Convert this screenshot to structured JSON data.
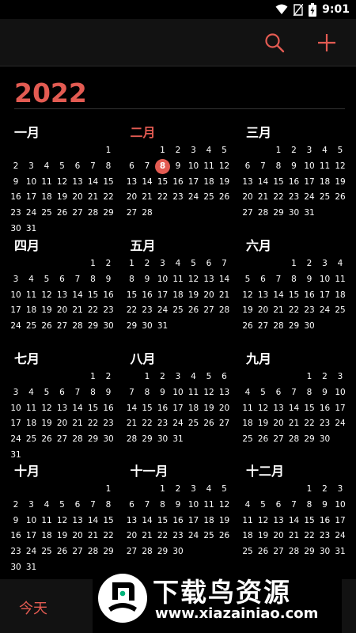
{
  "status_bar": {
    "time": "9:01",
    "icons": [
      "wifi-icon",
      "no-sim-icon",
      "battery-charging-icon"
    ]
  },
  "app_bar": {
    "icons": [
      "search-icon",
      "plus-icon"
    ]
  },
  "year": "2022",
  "months": [
    {
      "name": "一月",
      "weeks": [
        [
          "",
          "",
          "",
          "",
          "",
          "",
          "1"
        ],
        [
          "2",
          "3",
          "4",
          "5",
          "6",
          "7",
          "8"
        ],
        [
          "9",
          "10",
          "11",
          "12",
          "13",
          "14",
          "15"
        ],
        [
          "16",
          "17",
          "18",
          "19",
          "20",
          "21",
          "22"
        ],
        [
          "23",
          "24",
          "25",
          "26",
          "27",
          "28",
          "29"
        ],
        [
          "30",
          "31",
          "",
          "",
          "",
          "",
          ""
        ]
      ]
    },
    {
      "name": "二月",
      "current": true,
      "weeks": [
        [
          "",
          "",
          "1",
          "2",
          "3",
          "4",
          "5"
        ],
        [
          "6",
          "7",
          "8",
          "9",
          "10",
          "11",
          "12"
        ],
        [
          "13",
          "14",
          "15",
          "16",
          "17",
          "18",
          "19"
        ],
        [
          "20",
          "21",
          "22",
          "23",
          "24",
          "25",
          "26"
        ],
        [
          "27",
          "28",
          "",
          "",
          "",
          "",
          ""
        ]
      ]
    },
    {
      "name": "三月",
      "weeks": [
        [
          "",
          "",
          "1",
          "2",
          "3",
          "4",
          "5"
        ],
        [
          "6",
          "7",
          "8",
          "9",
          "10",
          "11",
          "12"
        ],
        [
          "13",
          "14",
          "15",
          "16",
          "17",
          "18",
          "19"
        ],
        [
          "20",
          "21",
          "22",
          "23",
          "24",
          "25",
          "26"
        ],
        [
          "27",
          "28",
          "29",
          "30",
          "31",
          "",
          ""
        ]
      ]
    },
    {
      "name": "四月",
      "weeks": [
        [
          "",
          "",
          "",
          "",
          "",
          "1",
          "2"
        ],
        [
          "3",
          "4",
          "5",
          "6",
          "7",
          "8",
          "9"
        ],
        [
          "10",
          "11",
          "12",
          "13",
          "14",
          "15",
          "16"
        ],
        [
          "17",
          "18",
          "19",
          "20",
          "21",
          "22",
          "23"
        ],
        [
          "24",
          "25",
          "26",
          "27",
          "28",
          "29",
          "30"
        ]
      ]
    },
    {
      "name": "五月",
      "weeks": [
        [
          "1",
          "2",
          "3",
          "4",
          "5",
          "6",
          "7"
        ],
        [
          "8",
          "9",
          "10",
          "11",
          "12",
          "13",
          "14"
        ],
        [
          "15",
          "16",
          "17",
          "18",
          "19",
          "20",
          "21"
        ],
        [
          "22",
          "23",
          "24",
          "25",
          "26",
          "27",
          "28"
        ],
        [
          "29",
          "30",
          "31",
          "",
          "",
          "",
          ""
        ]
      ]
    },
    {
      "name": "六月",
      "weeks": [
        [
          "",
          "",
          "",
          "1",
          "2",
          "3",
          "4"
        ],
        [
          "5",
          "6",
          "7",
          "8",
          "9",
          "10",
          "11"
        ],
        [
          "12",
          "13",
          "14",
          "15",
          "16",
          "17",
          "18"
        ],
        [
          "19",
          "20",
          "21",
          "22",
          "23",
          "24",
          "25"
        ],
        [
          "26",
          "27",
          "28",
          "29",
          "30",
          "",
          ""
        ]
      ]
    },
    {
      "name": "七月",
      "weeks": [
        [
          "",
          "",
          "",
          "",
          "",
          "1",
          "2"
        ],
        [
          "3",
          "4",
          "5",
          "6",
          "7",
          "8",
          "9"
        ],
        [
          "10",
          "11",
          "12",
          "13",
          "14",
          "15",
          "16"
        ],
        [
          "17",
          "18",
          "19",
          "20",
          "21",
          "22",
          "23"
        ],
        [
          "24",
          "25",
          "26",
          "27",
          "28",
          "29",
          "30"
        ],
        [
          "31",
          "",
          "",
          "",
          "",
          "",
          ""
        ]
      ]
    },
    {
      "name": "八月",
      "weeks": [
        [
          "",
          "1",
          "2",
          "3",
          "4",
          "5",
          "6"
        ],
        [
          "7",
          "8",
          "9",
          "10",
          "11",
          "12",
          "13"
        ],
        [
          "14",
          "15",
          "16",
          "17",
          "18",
          "19",
          "20"
        ],
        [
          "21",
          "22",
          "23",
          "24",
          "25",
          "26",
          "27"
        ],
        [
          "28",
          "29",
          "30",
          "31",
          "",
          "",
          ""
        ]
      ]
    },
    {
      "name": "九月",
      "weeks": [
        [
          "",
          "",
          "",
          "",
          "1",
          "2",
          "3"
        ],
        [
          "4",
          "5",
          "6",
          "7",
          "8",
          "9",
          "10"
        ],
        [
          "11",
          "12",
          "13",
          "14",
          "15",
          "16",
          "17"
        ],
        [
          "18",
          "19",
          "20",
          "21",
          "22",
          "23",
          "24"
        ],
        [
          "25",
          "26",
          "27",
          "28",
          "29",
          "30",
          ""
        ]
      ]
    },
    {
      "name": "十月",
      "weeks": [
        [
          "",
          "",
          "",
          "",
          "",
          "",
          "1"
        ],
        [
          "2",
          "3",
          "4",
          "5",
          "6",
          "7",
          "8"
        ],
        [
          "9",
          "10",
          "11",
          "12",
          "13",
          "14",
          "15"
        ],
        [
          "16",
          "17",
          "18",
          "19",
          "20",
          "21",
          "22"
        ],
        [
          "23",
          "24",
          "25",
          "26",
          "27",
          "28",
          "29"
        ],
        [
          "30",
          "31",
          "",
          "",
          "",
          "",
          ""
        ]
      ]
    },
    {
      "name": "十一月",
      "weeks": [
        [
          "",
          "",
          "1",
          "2",
          "3",
          "4",
          "5"
        ],
        [
          "6",
          "7",
          "8",
          "9",
          "10",
          "11",
          "12"
        ],
        [
          "13",
          "14",
          "15",
          "16",
          "17",
          "18",
          "19"
        ],
        [
          "20",
          "21",
          "22",
          "23",
          "24",
          "25",
          "26"
        ],
        [
          "27",
          "28",
          "29",
          "30",
          "",
          "",
          ""
        ]
      ]
    },
    {
      "name": "十二月",
      "weeks": [
        [
          "",
          "",
          "",
          "",
          "1",
          "2",
          "3"
        ],
        [
          "4",
          "5",
          "6",
          "7",
          "8",
          "9",
          "10"
        ],
        [
          "11",
          "12",
          "13",
          "14",
          "15",
          "16",
          "17"
        ],
        [
          "18",
          "19",
          "20",
          "21",
          "22",
          "23",
          "24"
        ],
        [
          "25",
          "26",
          "27",
          "28",
          "29",
          "30",
          "31"
        ]
      ]
    }
  ],
  "today": {
    "month_index": 1,
    "day": "8"
  },
  "bottom_bar": {
    "today_label": "今天"
  },
  "watermark": {
    "title": "下载鸟资源",
    "url": "www.xiazainiao.com"
  },
  "colors": {
    "accent": "#e35b52",
    "background": "#000000",
    "bar": "#121212",
    "text": "#ffffff"
  }
}
